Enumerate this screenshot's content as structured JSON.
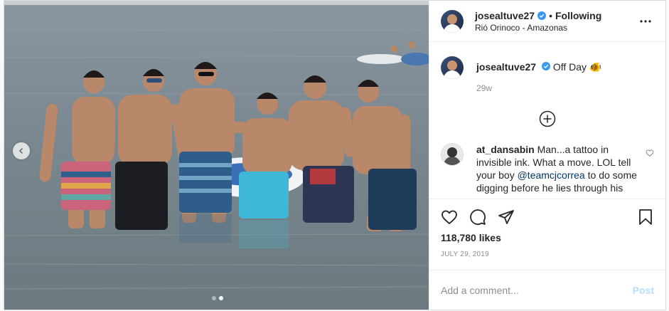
{
  "header": {
    "username": "josealtuve27",
    "separator": "•",
    "follow_label": "Following",
    "location": "Rió Orinoco - Amazonas"
  },
  "caption": {
    "username": "josealtuve27",
    "text": "Off Day 🐠",
    "time": "29w"
  },
  "comment": {
    "username": "at_dansabin",
    "text_1": "Man...a tattoo in invisible ink. What a move. LOL tell your boy ",
    "mention": "@teamcjcorrea",
    "text_2": " to do some digging before he lies through his"
  },
  "post": {
    "likes": "118,780 likes",
    "date": "JULY 29, 2019"
  },
  "add_comment": {
    "placeholder": "Add a comment...",
    "post_label": "Post"
  },
  "carousel": {
    "slide_count": 2,
    "active_index": 1
  },
  "colors": {
    "verified": "#3897f0",
    "link": "#00376b",
    "post_disabled": "#b2dffc",
    "muted": "#8e8e8e"
  }
}
